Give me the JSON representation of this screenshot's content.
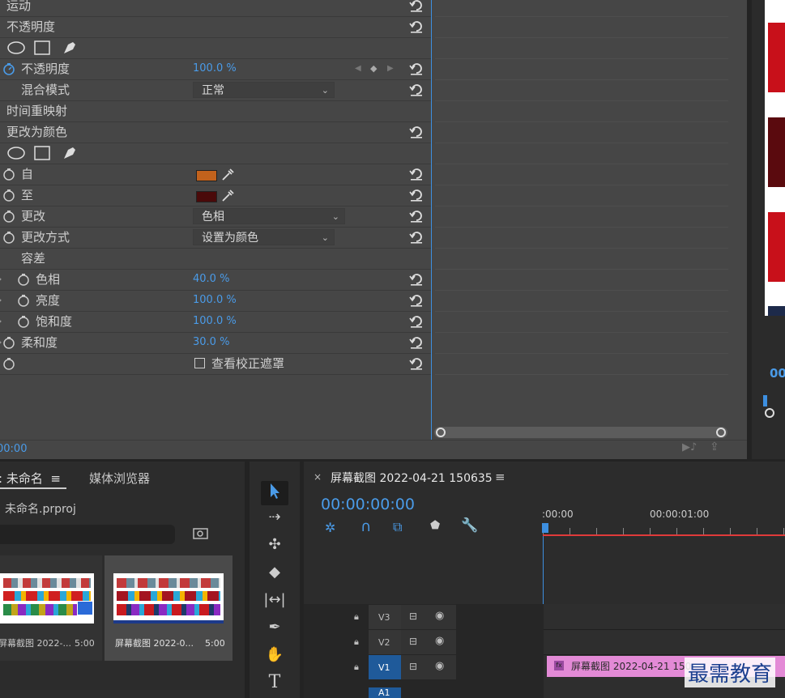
{
  "effects": {
    "motion": "运动",
    "opacity_section": "不透明度",
    "opacity_label": "不透明度",
    "opacity_value": "100.0 %",
    "blend_label": "混合模式",
    "blend_value": "正常",
    "time_remap": "时间重映射",
    "change_to_color": "更改为颜色",
    "from_label": "自",
    "from_color": "#c2621c",
    "to_label": "至",
    "to_color": "#4a0a0a",
    "change_label": "更改",
    "change_value": "色相",
    "change_method_label": "更改方式",
    "change_method_value": "设置为颜色",
    "tolerance_label": "容差",
    "hue_label": "色相",
    "hue_value": "40.0 %",
    "lightness_label": "亮度",
    "lightness_value": "100.0 %",
    "saturation_label": "饱和度",
    "saturation_value": "100.0 %",
    "softness_label": "柔和度",
    "softness_value": "30.0 %",
    "view_mask_label": "查看校正遮罩",
    "timecode": "00:00"
  },
  "right_preview": {
    "timecode": "00"
  },
  "project": {
    "tab_project": "未命名",
    "tab_media": "媒体浏览器",
    "file_name": "未命名.prproj",
    "items": [
      {
        "name": "屏幕截图 2022-...",
        "duration": "5:00"
      },
      {
        "name": "屏幕截图 2022-0...",
        "duration": "5:00"
      }
    ]
  },
  "sequence": {
    "close": "×",
    "title": "屏幕截图 2022-04-21 150635",
    "menu": "≡",
    "timecode": "00:00:00:00",
    "ruler_start": ":00:00",
    "ruler_1s": "00:00:01:00",
    "tracks": [
      "V3",
      "V2",
      "V1",
      "A1"
    ],
    "clip_label": "屏幕截图 2022-04-21  150",
    "fx": "fx"
  },
  "watermark": "最需教育",
  "colors": {
    "accent": "#3d8fe0",
    "playhead": "#e03a3a",
    "clip": "#e38ad6"
  }
}
